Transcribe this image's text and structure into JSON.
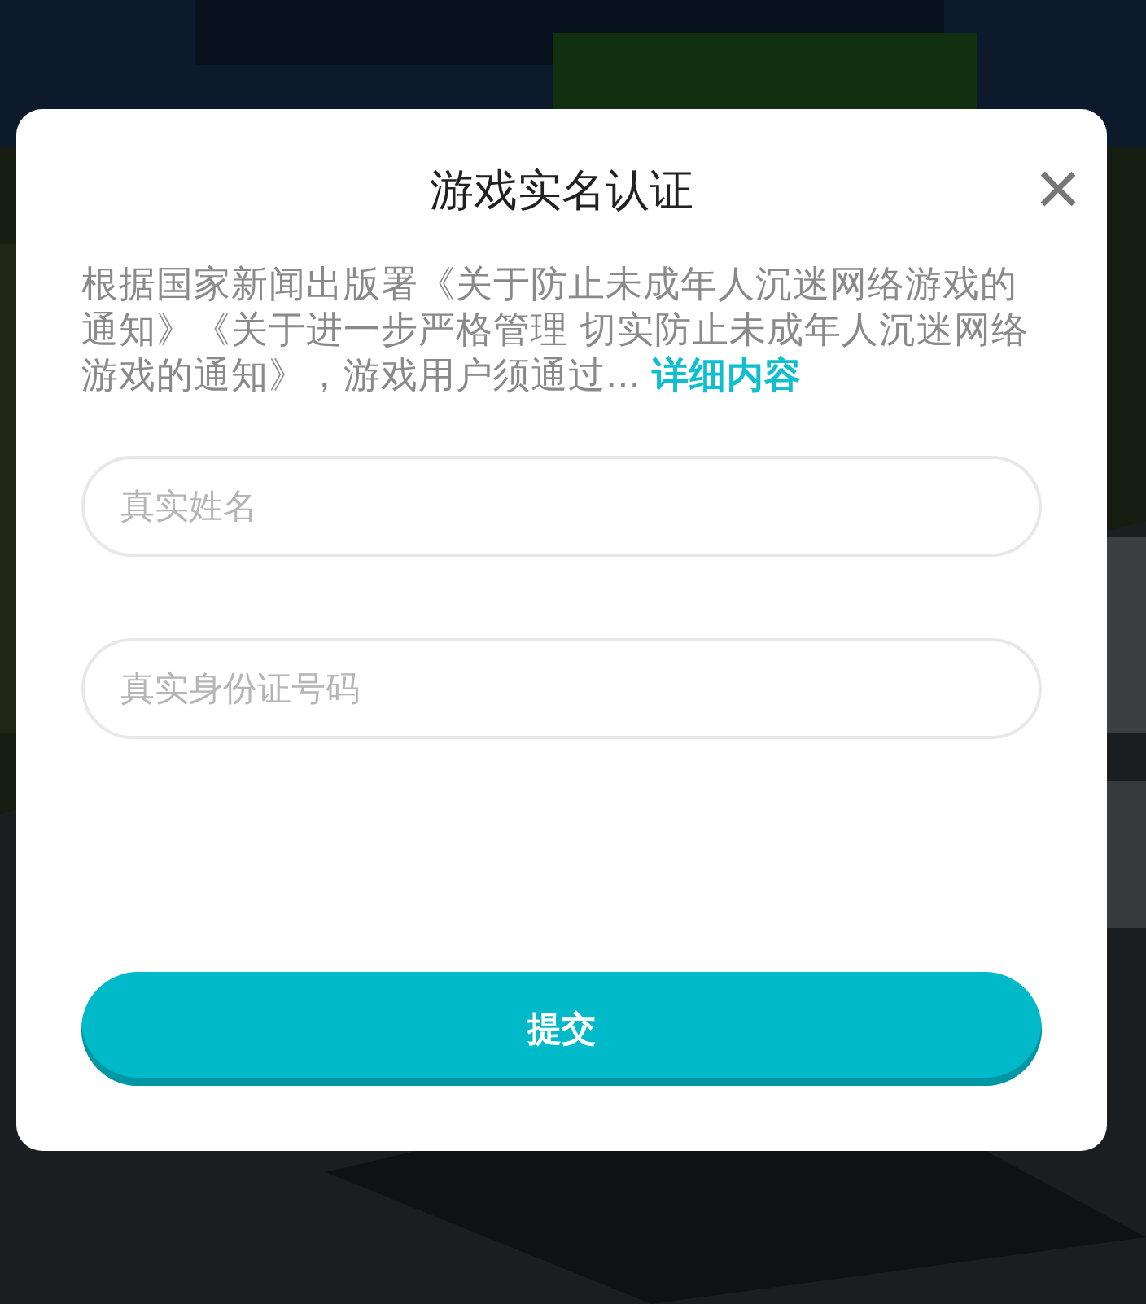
{
  "dialog": {
    "title": "游戏实名认证",
    "close": "×",
    "notice": "根据国家新闻出版署《关于防止未成年人沉迷网络游戏的通知》《关于进一步严格管理 切实防止未成年人沉迷网络游戏的通知》，游戏用户须通过... ",
    "link": "详细内容",
    "fields": [
      {
        "placeholder": "真实姓名"
      },
      {
        "placeholder": "真实身份证号码"
      }
    ],
    "submit": "提交"
  }
}
